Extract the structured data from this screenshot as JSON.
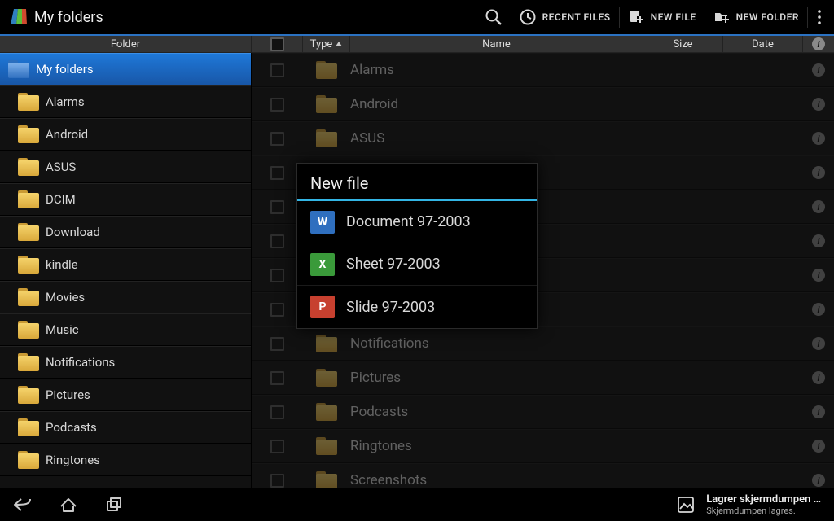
{
  "header": {
    "title": "My folders",
    "actions": {
      "recent_files": "RECENT FILES",
      "new_file": "NEW FILE",
      "new_folder": "NEW FOLDER"
    }
  },
  "columns": {
    "folder": "Folder",
    "type": "Type",
    "name": "Name",
    "size": "Size",
    "date": "Date"
  },
  "sidebar": {
    "root": "My folders",
    "items": [
      "Alarms",
      "Android",
      "ASUS",
      "DCIM",
      "Download",
      "kindle",
      "Movies",
      "Music",
      "Notifications",
      "Pictures",
      "Podcasts",
      "Ringtones"
    ]
  },
  "rows": [
    {
      "name": "Alarms"
    },
    {
      "name": "Android"
    },
    {
      "name": "ASUS"
    },
    {
      "name": ""
    },
    {
      "name": ""
    },
    {
      "name": ""
    },
    {
      "name": ""
    },
    {
      "name": ""
    },
    {
      "name": "Notifications"
    },
    {
      "name": "Pictures"
    },
    {
      "name": "Podcasts"
    },
    {
      "name": "Ringtones"
    },
    {
      "name": "Screenshots"
    }
  ],
  "dialog": {
    "title": "New file",
    "items": [
      {
        "label": "Document 97-2003",
        "color": "#2f6fbf",
        "glyph": "W"
      },
      {
        "label": "Sheet 97-2003",
        "color": "#3a9a3a",
        "glyph": "X"
      },
      {
        "label": "Slide 97-2003",
        "color": "#c7402f",
        "glyph": "P"
      }
    ]
  },
  "notification": {
    "title": "Lagrer skjermdumpen …",
    "subtitle": "Skjermdumpen lagres."
  }
}
